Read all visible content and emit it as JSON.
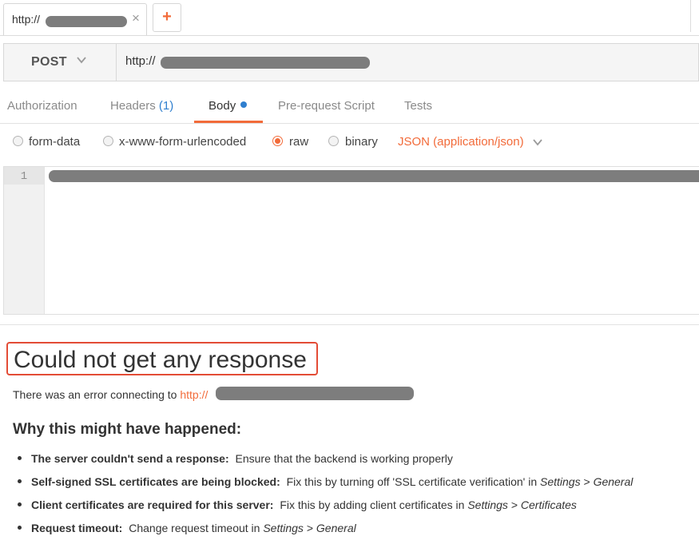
{
  "tab": {
    "label": "http://",
    "close_glyph": "×",
    "new_tab_glyph": "+"
  },
  "request": {
    "method": "POST",
    "url_prefix": "http://"
  },
  "subtabs": {
    "authorization": "Authorization",
    "headers": "Headers",
    "headers_count": "(1)",
    "body": "Body",
    "prerequest": "Pre-request Script",
    "tests": "Tests"
  },
  "body_types": {
    "form_data": "form-data",
    "urlencoded": "x-www-form-urlencoded",
    "raw": "raw",
    "binary": "binary",
    "selected": "raw",
    "content_type": "JSON (application/json)"
  },
  "editor": {
    "line_number": "1"
  },
  "response": {
    "title": "Could not get any response",
    "error_prefix": "There was an error connecting to",
    "error_link": "http://",
    "why_heading": "Why this might have happened:",
    "reasons": {
      "r1_bold": "The server couldn't send a response:",
      "r1_text": "Ensure that the backend is working properly",
      "r2_bold": "Self-signed SSL certificates are being blocked:",
      "r2_text": "Fix this by turning off 'SSL certificate verification' in",
      "r2_i1": "Settings",
      "r2_sep": ">",
      "r2_i2": "General",
      "r3_bold": "Client certificates are required for this server:",
      "r3_text": "Fix this by adding client certificates in",
      "r3_i1": "Settings",
      "r3_sep": ">",
      "r3_i2": "Certificates",
      "r4_bold": "Request timeout:",
      "r4_text": "Change request timeout in",
      "r4_i1": "Settings",
      "r4_sep": ">",
      "r4_i2": "General"
    }
  },
  "colors": {
    "accent": "#f26b3a",
    "link_blue": "#2f7fcf",
    "error_border": "#e34c36",
    "redaction": "#7d7d7d"
  },
  "icons": {
    "method_chevron": "chevron-down-icon",
    "ctype_chevron": "chevron-down-icon"
  }
}
